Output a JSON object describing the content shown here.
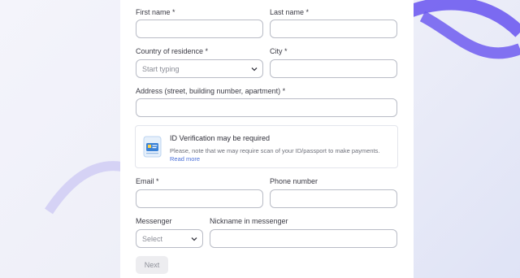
{
  "form": {
    "first_name_label": "First name *",
    "last_name_label": "Last name *",
    "country_label": "Country of residence *",
    "country_placeholder": "Start typing",
    "city_label": "City *",
    "address_label": "Address (street, building number, apartment) *",
    "email_label": "Email *",
    "phone_label": "Phone number",
    "messenger_label": "Messenger",
    "messenger_value": "Select",
    "nickname_label": "Nickname in messenger",
    "next_label": "Next"
  },
  "notice": {
    "title": "ID Verification may be required",
    "body": "Please, note that we may require scan of your ID/passport to make payments.",
    "link": "Read more",
    "icon": "id-card-icon"
  },
  "colors": {
    "accent": "#6f5cf0",
    "link": "#4a6fd8",
    "border": "#b9bcc6"
  }
}
